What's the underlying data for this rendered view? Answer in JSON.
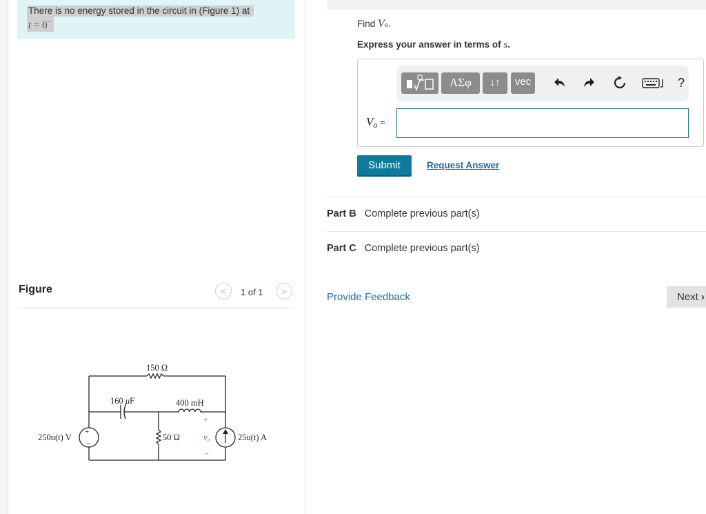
{
  "intro": {
    "text": "There is no energy stored in the circuit in (Figure 1) at",
    "math_var": "t",
    "math_eq": " = ",
    "math_val": "0",
    "math_sup": "−"
  },
  "figure": {
    "title": "Figure",
    "prev_icon": "chevron-left-icon",
    "next_icon": "chevron-right-icon",
    "prev_glyph": "<",
    "next_glyph": ">",
    "page": "1 of 1"
  },
  "circuit": {
    "r1": "150 Ω",
    "c1_prefix": "160 ",
    "c1_mu": "μ",
    "c1_unit": "F",
    "l1": "400 mH",
    "r2": "50 Ω",
    "vsrc": "250u(t) V",
    "isrc": "25u(t) A",
    "vo": "v",
    "vo_sub": "o",
    "plus": "+",
    "minus": "−"
  },
  "question": {
    "find_prefix": "Find ",
    "find_var": "V",
    "find_sub": "o",
    "find_end": ".",
    "express_prefix": "Express your answer in terms of ",
    "express_var": "s",
    "express_end": "."
  },
  "toolbar": {
    "greek": "ΑΣφ",
    "arrows": "↓↑",
    "vec": "vec",
    "undo_icon": "undo-icon",
    "redo_icon": "redo-icon",
    "reset_icon": "reset-icon",
    "keyboard_icon": "keyboard-icon",
    "help": "?"
  },
  "answer": {
    "label_var": "V",
    "label_sub": "o",
    "label_eq": " =",
    "value": ""
  },
  "actions": {
    "submit": "Submit",
    "request": "Request Answer"
  },
  "parts": [
    {
      "label": "Part B",
      "status": "Complete previous part(s)"
    },
    {
      "label": "Part C",
      "status": "Complete previous part(s)"
    }
  ],
  "footer": {
    "feedback": "Provide Feedback",
    "next": "Next"
  },
  "colors": {
    "intro_bg": "#e0f4f6",
    "submit_bg": "#0f7a9e",
    "link": "#1b6ca8"
  }
}
